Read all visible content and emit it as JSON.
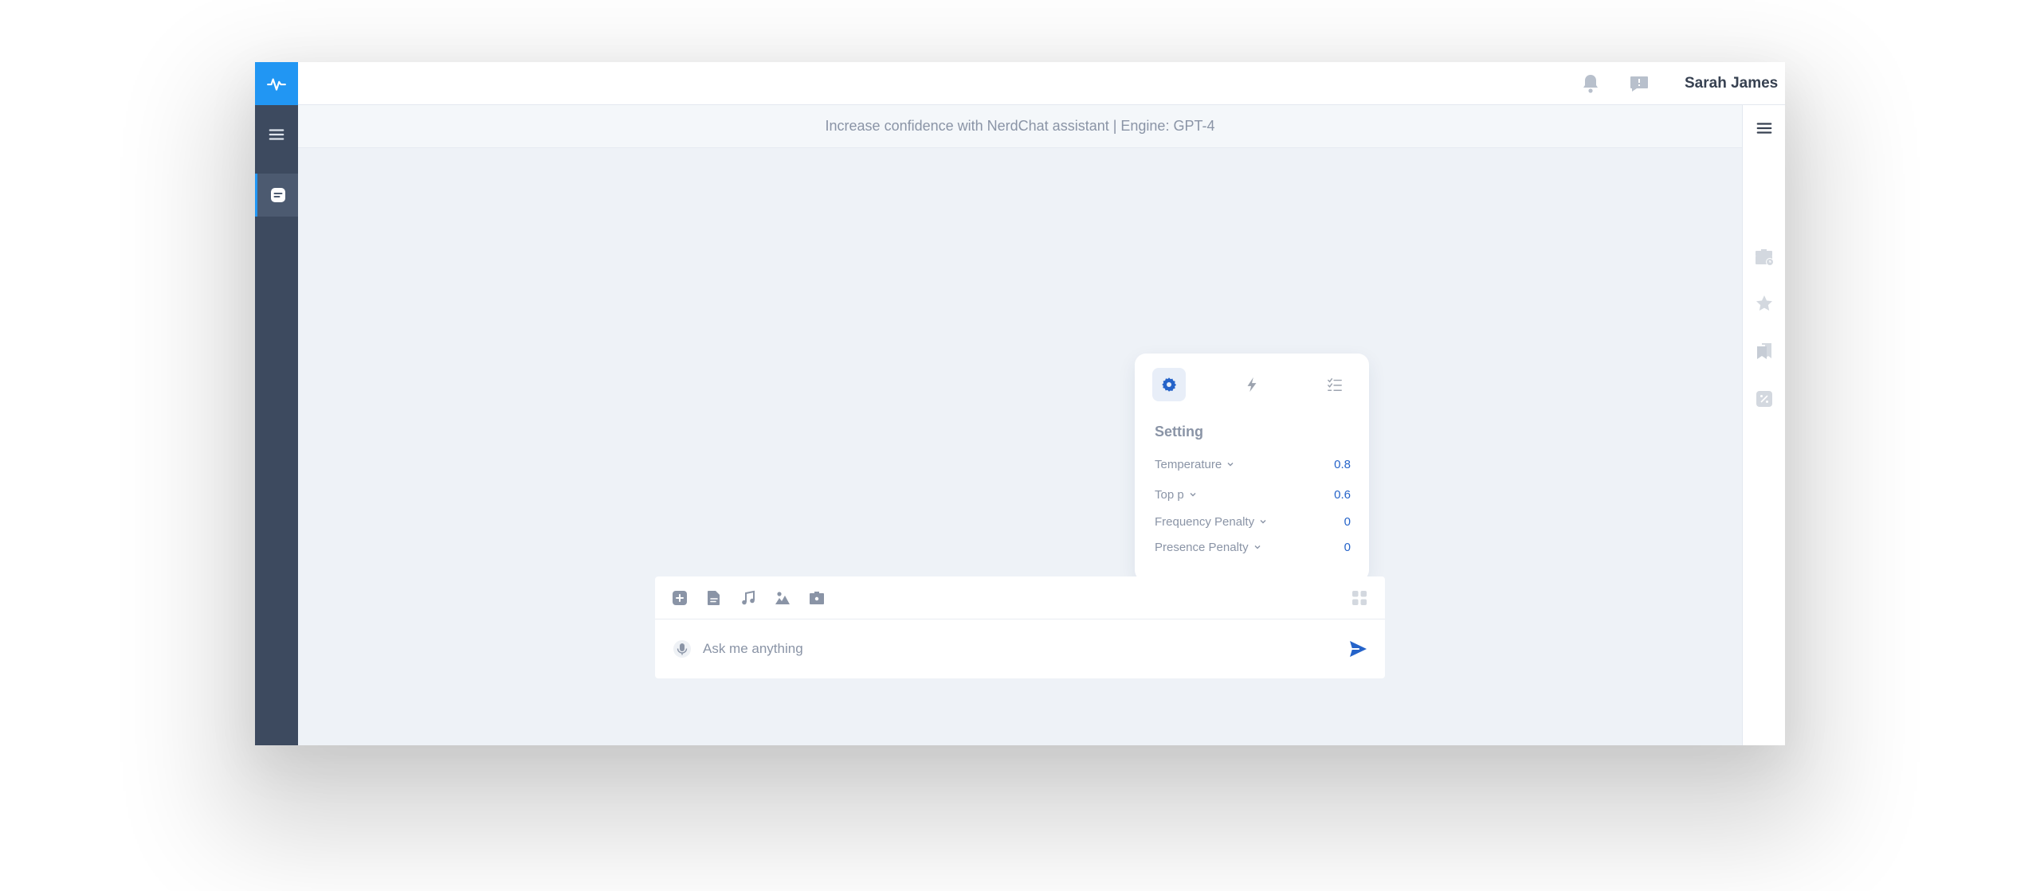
{
  "header": {
    "user_name": "Sarah James"
  },
  "subheader": {
    "title": "Increase confidence with NerdChat assistant | Engine: GPT-4"
  },
  "settings": {
    "title": "Setting",
    "params": [
      {
        "label": "Temperature",
        "value": "0.8"
      },
      {
        "label": "Top p",
        "value": "0.6"
      },
      {
        "label": "Frequency Penalty",
        "value": "0"
      },
      {
        "label": "Presence Penalty",
        "value": "0"
      }
    ],
    "tabs": [
      "gear-icon",
      "lightning-icon",
      "checklist-icon"
    ]
  },
  "composer": {
    "placeholder": "Ask me anything",
    "tools": [
      "add-icon",
      "document-icon",
      "music-icon",
      "image-icon",
      "briefcase-icon"
    ]
  },
  "colors": {
    "accent": "#2196f3",
    "rail": "#3d4a5f",
    "value_blue": "#2563c9",
    "muted": "#8a94a6"
  }
}
